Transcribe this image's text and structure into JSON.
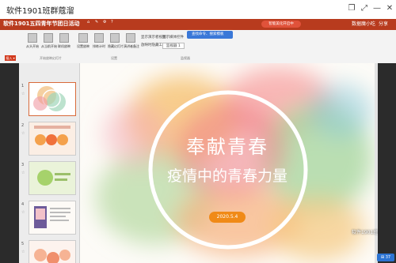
{
  "window": {
    "title": "软件1901班群蔻溜",
    "minimize": "—",
    "restore": "❐",
    "expand": "⤢",
    "close": "✕"
  },
  "app": {
    "doc_title": "软件1901五四青年节团日活动",
    "status_pill": "智能美化开启中",
    "account": "数据魔小吃",
    "share": "分享",
    "ribbon_tab_icons": [
      "⌂",
      "✎",
      "⚙",
      "?"
    ]
  },
  "ribbon": {
    "left_button": "插入 ▾",
    "buttons": [
      {
        "label": "从头开始"
      },
      {
        "label": "从当前开始"
      },
      {
        "label": "联机放映"
      },
      {
        "label": "设置放映"
      },
      {
        "label": "排练计时"
      },
      {
        "label": "隐藏幻灯片"
      },
      {
        "label": "演讲者备注"
      }
    ],
    "checks": [
      "显示演示者视图",
      "放映时隐藏工具",
      "显示媒体控件"
    ],
    "dropdown": "监视器 1",
    "search_placeholder": "查找命令、搜索模板",
    "groups": [
      "开始放映幻灯片",
      "设置",
      "监视器"
    ]
  },
  "slides": [
    {
      "num": "1",
      "selected": true
    },
    {
      "num": "2",
      "selected": false
    },
    {
      "num": "3",
      "selected": false
    },
    {
      "num": "4",
      "selected": false
    },
    {
      "num": "5",
      "selected": false
    }
  ],
  "slide": {
    "title": "奉献青春",
    "subtitle": "疫情中的青春力量",
    "date": "2020.5.4"
  },
  "statusbar": {
    "badge": "⊞ 37"
  },
  "watermark": "软件1901班"
}
